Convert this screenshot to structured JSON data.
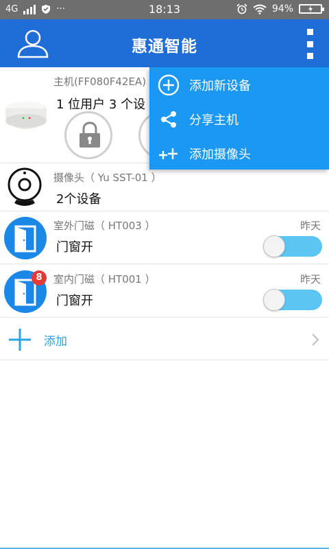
{
  "status_bar": {
    "network": "4G",
    "dots": "···",
    "time": "18:13",
    "battery": "94%"
  },
  "header": {
    "title": "惠通智能",
    "user_icon": "user-icon",
    "more_icon": "more-vertical-icon"
  },
  "host": {
    "subtitle": "主机(FF080F42EA)",
    "summary": "1 位用户  3 个设",
    "lock_icon": "lock-icon"
  },
  "camera": {
    "subtitle": "摄像头（ Yu SST-01 ）",
    "summary": "2个设备"
  },
  "sensors": [
    {
      "subtitle": "室外门磁（  HT003  ）",
      "status": "门窗开",
      "time": "昨天",
      "badge": ""
    },
    {
      "subtitle": "室内门磁（  HT001  ）",
      "status": "门窗开",
      "time": "昨天",
      "badge": "8"
    }
  ],
  "add": {
    "label": "添加"
  },
  "menu": {
    "items": [
      {
        "label": "添加新设备",
        "icon": "plus-circle-icon"
      },
      {
        "label": "分享主机",
        "icon": "share-icon"
      },
      {
        "label": "添加摄像头",
        "icon": "add-camera-icon"
      }
    ]
  },
  "colors": {
    "header": "#1f6dd7",
    "menu": "#1a98f3",
    "toggle_track": "#5cc6f3",
    "accent": "#29a4e8"
  }
}
